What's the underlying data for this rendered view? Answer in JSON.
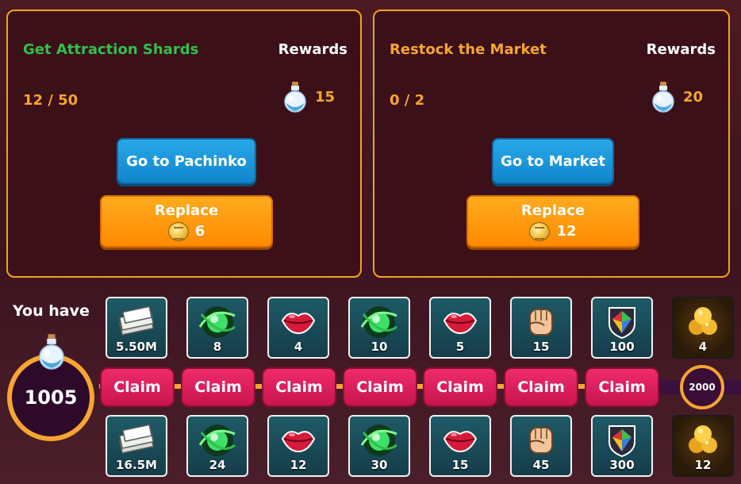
{
  "tasks": [
    {
      "title": "Get Attraction Shards",
      "rewards_label": "Rewards",
      "progress": "12 / 50",
      "reward_value": "15",
      "go_label": "Go to Pachinko",
      "replace_label": "Replace",
      "replace_cost": "6"
    },
    {
      "title": "Restock the Market",
      "rewards_label": "Rewards",
      "progress": "0 / 2",
      "reward_value": "20",
      "go_label": "Go to Market",
      "replace_label": "Replace",
      "replace_cost": "12"
    }
  ],
  "balance": {
    "label": "You have",
    "value": "1005"
  },
  "track": {
    "claim_label": "Claim",
    "milestone": "2000",
    "top_rewards": [
      {
        "icon": "money-icon",
        "value": "5.50M"
      },
      {
        "icon": "shard-orb-icon",
        "value": "8"
      },
      {
        "icon": "lips-icon",
        "value": "4"
      },
      {
        "icon": "shard-orb-icon",
        "value": "10"
      },
      {
        "icon": "lips-icon",
        "value": "5"
      },
      {
        "icon": "fist-icon",
        "value": "15"
      },
      {
        "icon": "gem-shield-icon",
        "value": "100"
      },
      {
        "icon": "gold-trophy-icon",
        "value": "4"
      }
    ],
    "bottom_rewards": [
      {
        "icon": "money-icon",
        "value": "16.5M"
      },
      {
        "icon": "shard-orb-icon",
        "value": "24"
      },
      {
        "icon": "lips-icon",
        "value": "12"
      },
      {
        "icon": "shard-orb-icon",
        "value": "30"
      },
      {
        "icon": "lips-icon",
        "value": "15"
      },
      {
        "icon": "fist-icon",
        "value": "45"
      },
      {
        "icon": "gem-shield-icon",
        "value": "300"
      },
      {
        "icon": "gold-trophy-icon",
        "value": "12"
      }
    ]
  },
  "colors": {
    "accent_orange": "#f7a532",
    "title_green": "#33c04a",
    "button_blue": "#1a95d8",
    "claim_pink": "#e0205e"
  }
}
